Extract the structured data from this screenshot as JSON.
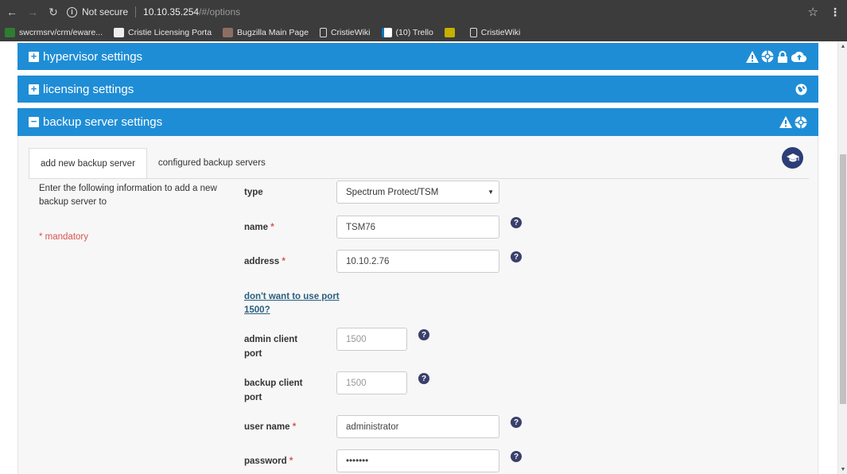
{
  "browser": {
    "security_label": "Not secure",
    "url_host": "10.10.35.254",
    "url_path": "/#/options",
    "bookmarks": [
      {
        "label": "swcrmsrv/crm/eware..."
      },
      {
        "label": "Cristie Licensing Porta"
      },
      {
        "label": "Bugzilla Main Page"
      },
      {
        "label": "CristieWiki"
      },
      {
        "label": "(10) Trello"
      },
      {
        "label": ""
      },
      {
        "label": "CristieWiki"
      }
    ]
  },
  "panels": {
    "hypervisor": {
      "title": "hypervisor settings",
      "toggle": "+"
    },
    "licensing": {
      "title": "licensing settings",
      "toggle": "+"
    },
    "backup": {
      "title": "backup server settings",
      "toggle": "−"
    }
  },
  "tabs": [
    {
      "label": "add new backup server",
      "active": true
    },
    {
      "label": "configured backup servers",
      "active": false
    }
  ],
  "form": {
    "intro": "Enter the following information to add a new backup server to",
    "mandatory_note": "* mandatory",
    "type": {
      "label": "type",
      "value": "Spectrum Protect/TSM"
    },
    "name": {
      "label": "name",
      "required": "*",
      "value": "TSM76"
    },
    "address": {
      "label": "address",
      "required": "*",
      "value": "10.10.2.76"
    },
    "port_link": "don't want to use port 1500?",
    "admin_port": {
      "label": "admin client port",
      "placeholder": "1500"
    },
    "backup_port": {
      "label": "backup client port",
      "placeholder": "1500"
    },
    "user_name": {
      "label": "user name",
      "required": "*",
      "value": "administrator"
    },
    "password": {
      "label": "password",
      "required": "*",
      "value": "•••••••"
    }
  },
  "colors": {
    "panel_header": "#1f8dd6",
    "help_icon": "#3a3f6b",
    "required": "#d9534f",
    "link": "#2a5f7e"
  }
}
